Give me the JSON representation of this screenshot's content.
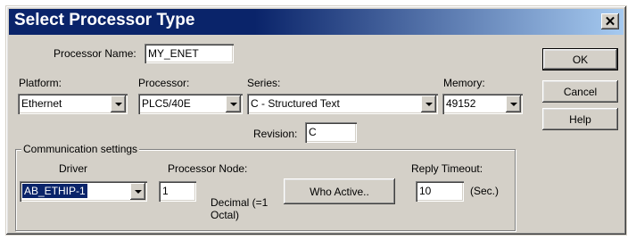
{
  "window": {
    "title": "Select Processor Type",
    "close_glyph": "✕"
  },
  "processor_name": {
    "label": "Processor Name:",
    "value": "MY_ENET"
  },
  "platform": {
    "label": "Platform:",
    "value": "Ethernet"
  },
  "processor": {
    "label": "Processor:",
    "value": "PLC5/40E"
  },
  "series": {
    "label": "Series:",
    "value": "C - Structured Text"
  },
  "memory": {
    "label": "Memory:",
    "value": "49152"
  },
  "revision": {
    "label": "Revision:",
    "value": "C"
  },
  "buttons": {
    "ok": "OK",
    "cancel": "Cancel",
    "help": "Help"
  },
  "comm": {
    "legend": "Communication settings",
    "driver_label": "Driver",
    "driver_value": "AB_ETHIP-1",
    "node_label": "Processor Node:",
    "node_value": "1",
    "node_hint": "Decimal (=1 Octal)",
    "who_active": "Who Active..",
    "timeout_label": "Reply Timeout:",
    "timeout_value": "10",
    "timeout_unit": "(Sec.)"
  },
  "icons": {
    "dropdown_arrow": "chevron-down-icon"
  },
  "colors": {
    "title_bar": "#0a246a",
    "dialog_face": "#d4d0c8",
    "selection": "#0a246a"
  }
}
